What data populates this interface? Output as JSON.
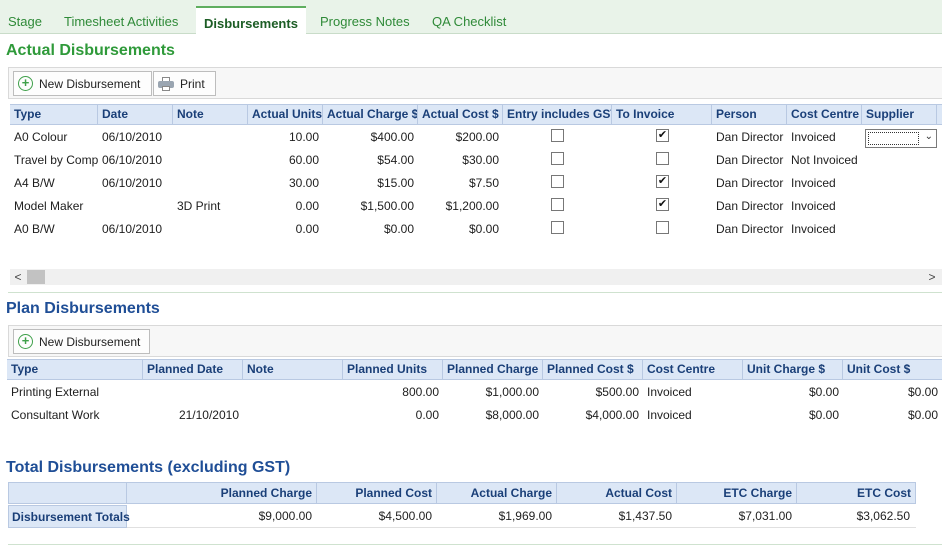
{
  "tabs": [
    {
      "label": "Stage",
      "active": false
    },
    {
      "label": "Timesheet Activities",
      "active": false
    },
    {
      "label": "Disbursements",
      "active": true
    },
    {
      "label": "Progress Notes",
      "active": false
    },
    {
      "label": "QA Checklist",
      "active": false
    }
  ],
  "actual": {
    "title": "Actual Disbursements",
    "new_button": "New Disbursement",
    "print_button": "Print",
    "columns": [
      "Type",
      "Date",
      "Note",
      "Actual Units",
      "Actual Charge $",
      "Actual Cost $",
      "Entry includes GST",
      "To Invoice",
      "Person",
      "Cost Centre",
      "Supplier"
    ],
    "rows": [
      {
        "type": "A0 Colour",
        "date": "06/10/2010",
        "note": "",
        "units": "10.00",
        "charge": "$400.00",
        "cost": "$200.00",
        "gst": false,
        "invoice": true,
        "person": "Dan Director",
        "cost_centre": "Invoiced",
        "supplier": ""
      },
      {
        "type": "Travel by Comp",
        "date": "06/10/2010",
        "note": "",
        "units": "60.00",
        "charge": "$54.00",
        "cost": "$30.00",
        "gst": false,
        "invoice": false,
        "person": "Dan Director",
        "cost_centre": "Not Invoiced",
        "supplier": ""
      },
      {
        "type": "A4 B/W",
        "date": "06/10/2010",
        "note": "",
        "units": "30.00",
        "charge": "$15.00",
        "cost": "$7.50",
        "gst": false,
        "invoice": true,
        "person": "Dan Director",
        "cost_centre": "Invoiced",
        "supplier": ""
      },
      {
        "type": "Model Maker",
        "date": "",
        "note": "3D Print",
        "units": "0.00",
        "charge": "$1,500.00",
        "cost": "$1,200.00",
        "gst": false,
        "invoice": true,
        "person": "Dan Director",
        "cost_centre": "Invoiced",
        "supplier": ""
      },
      {
        "type": "A0 B/W",
        "date": "06/10/2010",
        "note": "",
        "units": "0.00",
        "charge": "$0.00",
        "cost": "$0.00",
        "gst": false,
        "invoice": false,
        "person": "Dan Director",
        "cost_centre": "Invoiced",
        "supplier": ""
      }
    ],
    "scroll_left": "<",
    "scroll_right": ">"
  },
  "plan": {
    "title": "Plan Disbursements",
    "new_button": "New Disbursement",
    "columns": [
      "Type",
      "Planned Date",
      "Note",
      "Planned Units",
      "Planned Charge $",
      "Planned Cost $",
      "Cost Centre",
      "Unit Charge $",
      "Unit Cost $"
    ],
    "rows": [
      {
        "type": "Printing External",
        "date": "",
        "note": "",
        "units": "800.00",
        "charge": "$1,000.00",
        "cost": "$500.00",
        "cost_centre": "Invoiced",
        "unit_charge": "$0.00",
        "unit_cost": "$0.00"
      },
      {
        "type": "Consultant Work",
        "date": "21/10/2010",
        "note": "",
        "units": "0.00",
        "charge": "$8,000.00",
        "cost": "$4,000.00",
        "cost_centre": "Invoiced",
        "unit_charge": "$0.00",
        "unit_cost": "$0.00"
      }
    ]
  },
  "totals": {
    "title": "Total Disbursements  (excluding GST)",
    "columns": [
      "Planned Charge",
      "Planned Cost",
      "Actual Charge",
      "Actual Cost",
      "ETC Charge",
      "ETC Cost"
    ],
    "row_label": "Disbursement Totals",
    "values": [
      "$9,000.00",
      "$4,500.00",
      "$1,969.00",
      "$1,437.50",
      "$7,031.00",
      "$3,062.50"
    ]
  },
  "colors": {
    "tab_green": "#2f9a3a",
    "heading_blue": "#1f4e96",
    "grid_header": "#dce7f6"
  },
  "checkmark": "✔",
  "dropdown_arrow": "⌄"
}
